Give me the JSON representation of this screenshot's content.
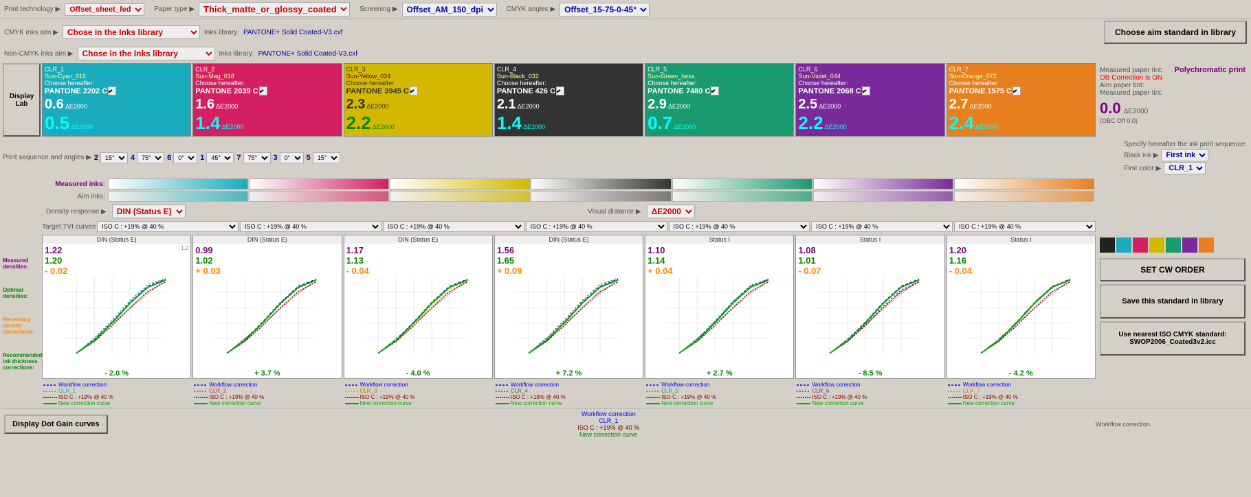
{
  "header": {
    "print_tech_label": "Print technology ▶",
    "print_tech_value": "Offset_sheet_fed",
    "paper_type_label": "Paper type ▶",
    "paper_type_value": "Thick_matte_or_glossy_coated",
    "screening_label": "Screening ▶",
    "screening_value": "Offset_AM_150_dpi",
    "cmyk_angles_label": "CMYK angles ▶",
    "cmyk_angles_value": "Offset_15-75-0-45°"
  },
  "inks": {
    "cmyk_aim_label": "CMYK inks aim ▶",
    "cmyk_choose": "Chose in the Inks library",
    "cmyk_library_label": "Inks library:",
    "cmyk_library_file": "PANTONE+ Solid Coated-V3.cxf",
    "non_cmyk_aim_label": "Non-CMYK inks aim ▶",
    "non_cmyk_choose": "Chose in the Inks library",
    "non_cmyk_library_label": "Inks library:",
    "non_cmyk_library_file": "PANTONE+ Solid Coated-V3.cxf",
    "choose_aim_btn": "Choose aim standard in library"
  },
  "colors": [
    {
      "id": "CLR_1",
      "bg": "#1aabbc",
      "device_name": "CLR_1",
      "measured_ink": "Sun-Cyan_015",
      "choose_label": "Choose hereafter:",
      "aim_ink": "PANTONE 2202 C",
      "measured_dist": "0.6",
      "opt_dist": "0.5",
      "de_label": "ΔE2000"
    },
    {
      "id": "CLR_2",
      "bg": "#d42060",
      "device_name": "CLR_2",
      "measured_ink": "Sun-Mag_018",
      "choose_label": "Choose hereafter:",
      "aim_ink": "PANTONE 2039 C",
      "measured_dist": "1.6",
      "opt_dist": "1.4",
      "de_label": "ΔE2000"
    },
    {
      "id": "CLR_3",
      "bg": "#eecc00",
      "device_name": "CLR_3",
      "measured_ink": "Sun-Yellow_024",
      "choose_label": "Choose hereafter:",
      "aim_ink": "PANTONE 3945 C",
      "measured_dist": "2.3",
      "opt_dist": "2.2",
      "de_label": "ΔE2000"
    },
    {
      "id": "CLR_4",
      "bg": "#333333",
      "device_name": "CLR_4",
      "measured_ink": "Sun-Black_032",
      "choose_label": "Choose hereafter:",
      "aim_ink": "PANTONE 426 C",
      "measured_dist": "2.1",
      "opt_dist": "1.4",
      "de_label": "ΔE2000"
    },
    {
      "id": "CLR_5",
      "bg": "#1a9a70",
      "device_name": "CLR_5",
      "measured_ink": "Sun-Green_hexa",
      "choose_label": "Choose hereafter:",
      "aim_ink": "PANTONE 7480 C",
      "measured_dist": "2.9",
      "opt_dist": "0.7",
      "de_label": "ΔE2000"
    },
    {
      "id": "CLR_6",
      "bg": "#7a2a9a",
      "device_name": "CLR_6",
      "measured_ink": "Sun-Violet_044",
      "choose_label": "Choose hereafter:",
      "aim_ink": "PANTONE 2068 C",
      "measured_dist": "2.5",
      "opt_dist": "2.2",
      "de_label": "ΔE2000"
    },
    {
      "id": "CLR_7",
      "bg": "#e88020",
      "device_name": "CLR_7",
      "measured_ink": "Sun-Orange_072",
      "choose_label": "Choose hereafter:",
      "aim_ink": "PANTONE 1575 C",
      "measured_dist": "2.7",
      "opt_dist": "2.4",
      "de_label": "ΔE2000"
    }
  ],
  "paper": {
    "meas_paper_label": "Measured paper tint:",
    "polychromatic": "Polychromatic print",
    "obc_label": "OB Correction is ON",
    "aim_paper_label": "Aim paper tint:",
    "meas_paper_val_label": "Measured paper tint:",
    "meas_paper_val": "0.0",
    "de_label": "ΔE2000",
    "obc_off": "(OBC Off 0.0)"
  },
  "print_sequence": {
    "label": "Print sequence and angles ▶",
    "items": [
      {
        "num": "2",
        "angle": "15°"
      },
      {
        "num": "4",
        "angle": "75°"
      },
      {
        "num": "6",
        "angle": "0°"
      },
      {
        "num": "1",
        "angle": "45°"
      },
      {
        "num": "7",
        "angle": "75°"
      },
      {
        "num": "3",
        "angle": "0°"
      },
      {
        "num": "5",
        "angle": "15°"
      }
    ]
  },
  "ink_sequence": {
    "specify_label": "Specify hereafter the ink print sequence:",
    "black_ink_label": "Black ink ▶",
    "black_ink_value": "First ink",
    "first_color_label": "First color ▶",
    "first_color_value": "CLR_1"
  },
  "swatches": {
    "measured_label": "Measured inks:",
    "aim_label": "Aim inks:",
    "colors": [
      "#1aabbc",
      "#d42060",
      "#eecc00",
      "#333333",
      "#1a9a70",
      "#7a2a9a",
      "#e88020"
    ]
  },
  "density": {
    "density_label": "Density response ▶",
    "density_value": "DIN (Status E)",
    "visual_dist_label": "Visual distance ▶",
    "visual_dist_value": "ΔE2000"
  },
  "tvi": {
    "label": "Target TVI curves",
    "value": "ISO C : +19% @ 40 %"
  },
  "charts": [
    {
      "title": "DIN (Status E)",
      "measured_density": "1.22",
      "optimal_density": "1.20",
      "density_correction": "- 0.02",
      "ink_thickness": "- 2.0 %",
      "color": "#1aabbc"
    },
    {
      "title": "DIN (Status E)",
      "measured_density": "0.99",
      "optimal_density": "1.02",
      "density_correction": "+ 0.03",
      "ink_thickness": "+ 3.7 %",
      "color": "#d42060"
    },
    {
      "title": "DIN (Status E)",
      "measured_density": "1.17",
      "optimal_density": "1.13",
      "density_correction": "- 0.04",
      "ink_thickness": "- 4.0 %",
      "color": "#eecc00"
    },
    {
      "title": "DIN (Status E)",
      "measured_density": "1.56",
      "optimal_density": "1.65",
      "density_correction": "+ 0.09",
      "ink_thickness": "+ 7.2 %",
      "color": "#333333"
    },
    {
      "title": "Status I",
      "measured_density": "1.10",
      "optimal_density": "1.14",
      "density_correction": "+ 0.04",
      "ink_thickness": "+ 2.7 %",
      "color": "#1a9a70"
    },
    {
      "title": "Status I",
      "measured_density": "1.08",
      "optimal_density": "1.01",
      "density_correction": "- 0.07",
      "ink_thickness": "- 8.5 %",
      "color": "#7a2a9a"
    },
    {
      "title": "Status I",
      "measured_density": "1.20",
      "optimal_density": "1.16",
      "density_correction": "- 0.04",
      "ink_thickness": "- 4.2 %",
      "color": "#e88020"
    }
  ],
  "legend": {
    "workflow_correction": "Workflow correction",
    "clr_label": "CLR_",
    "iso_label": "ISO C : +19% @ 40 %",
    "new_correction": "New correction curve"
  },
  "right_panel": {
    "set_cw_order": "SET CW ORDER",
    "save_standard": "Save this standard in library",
    "use_nearest": "Use nearest ISO CMYK standard: SWOP2006_Coated3v2.icc"
  },
  "bottom": {
    "display_dot_gain": "Display Dot Gain curves"
  }
}
